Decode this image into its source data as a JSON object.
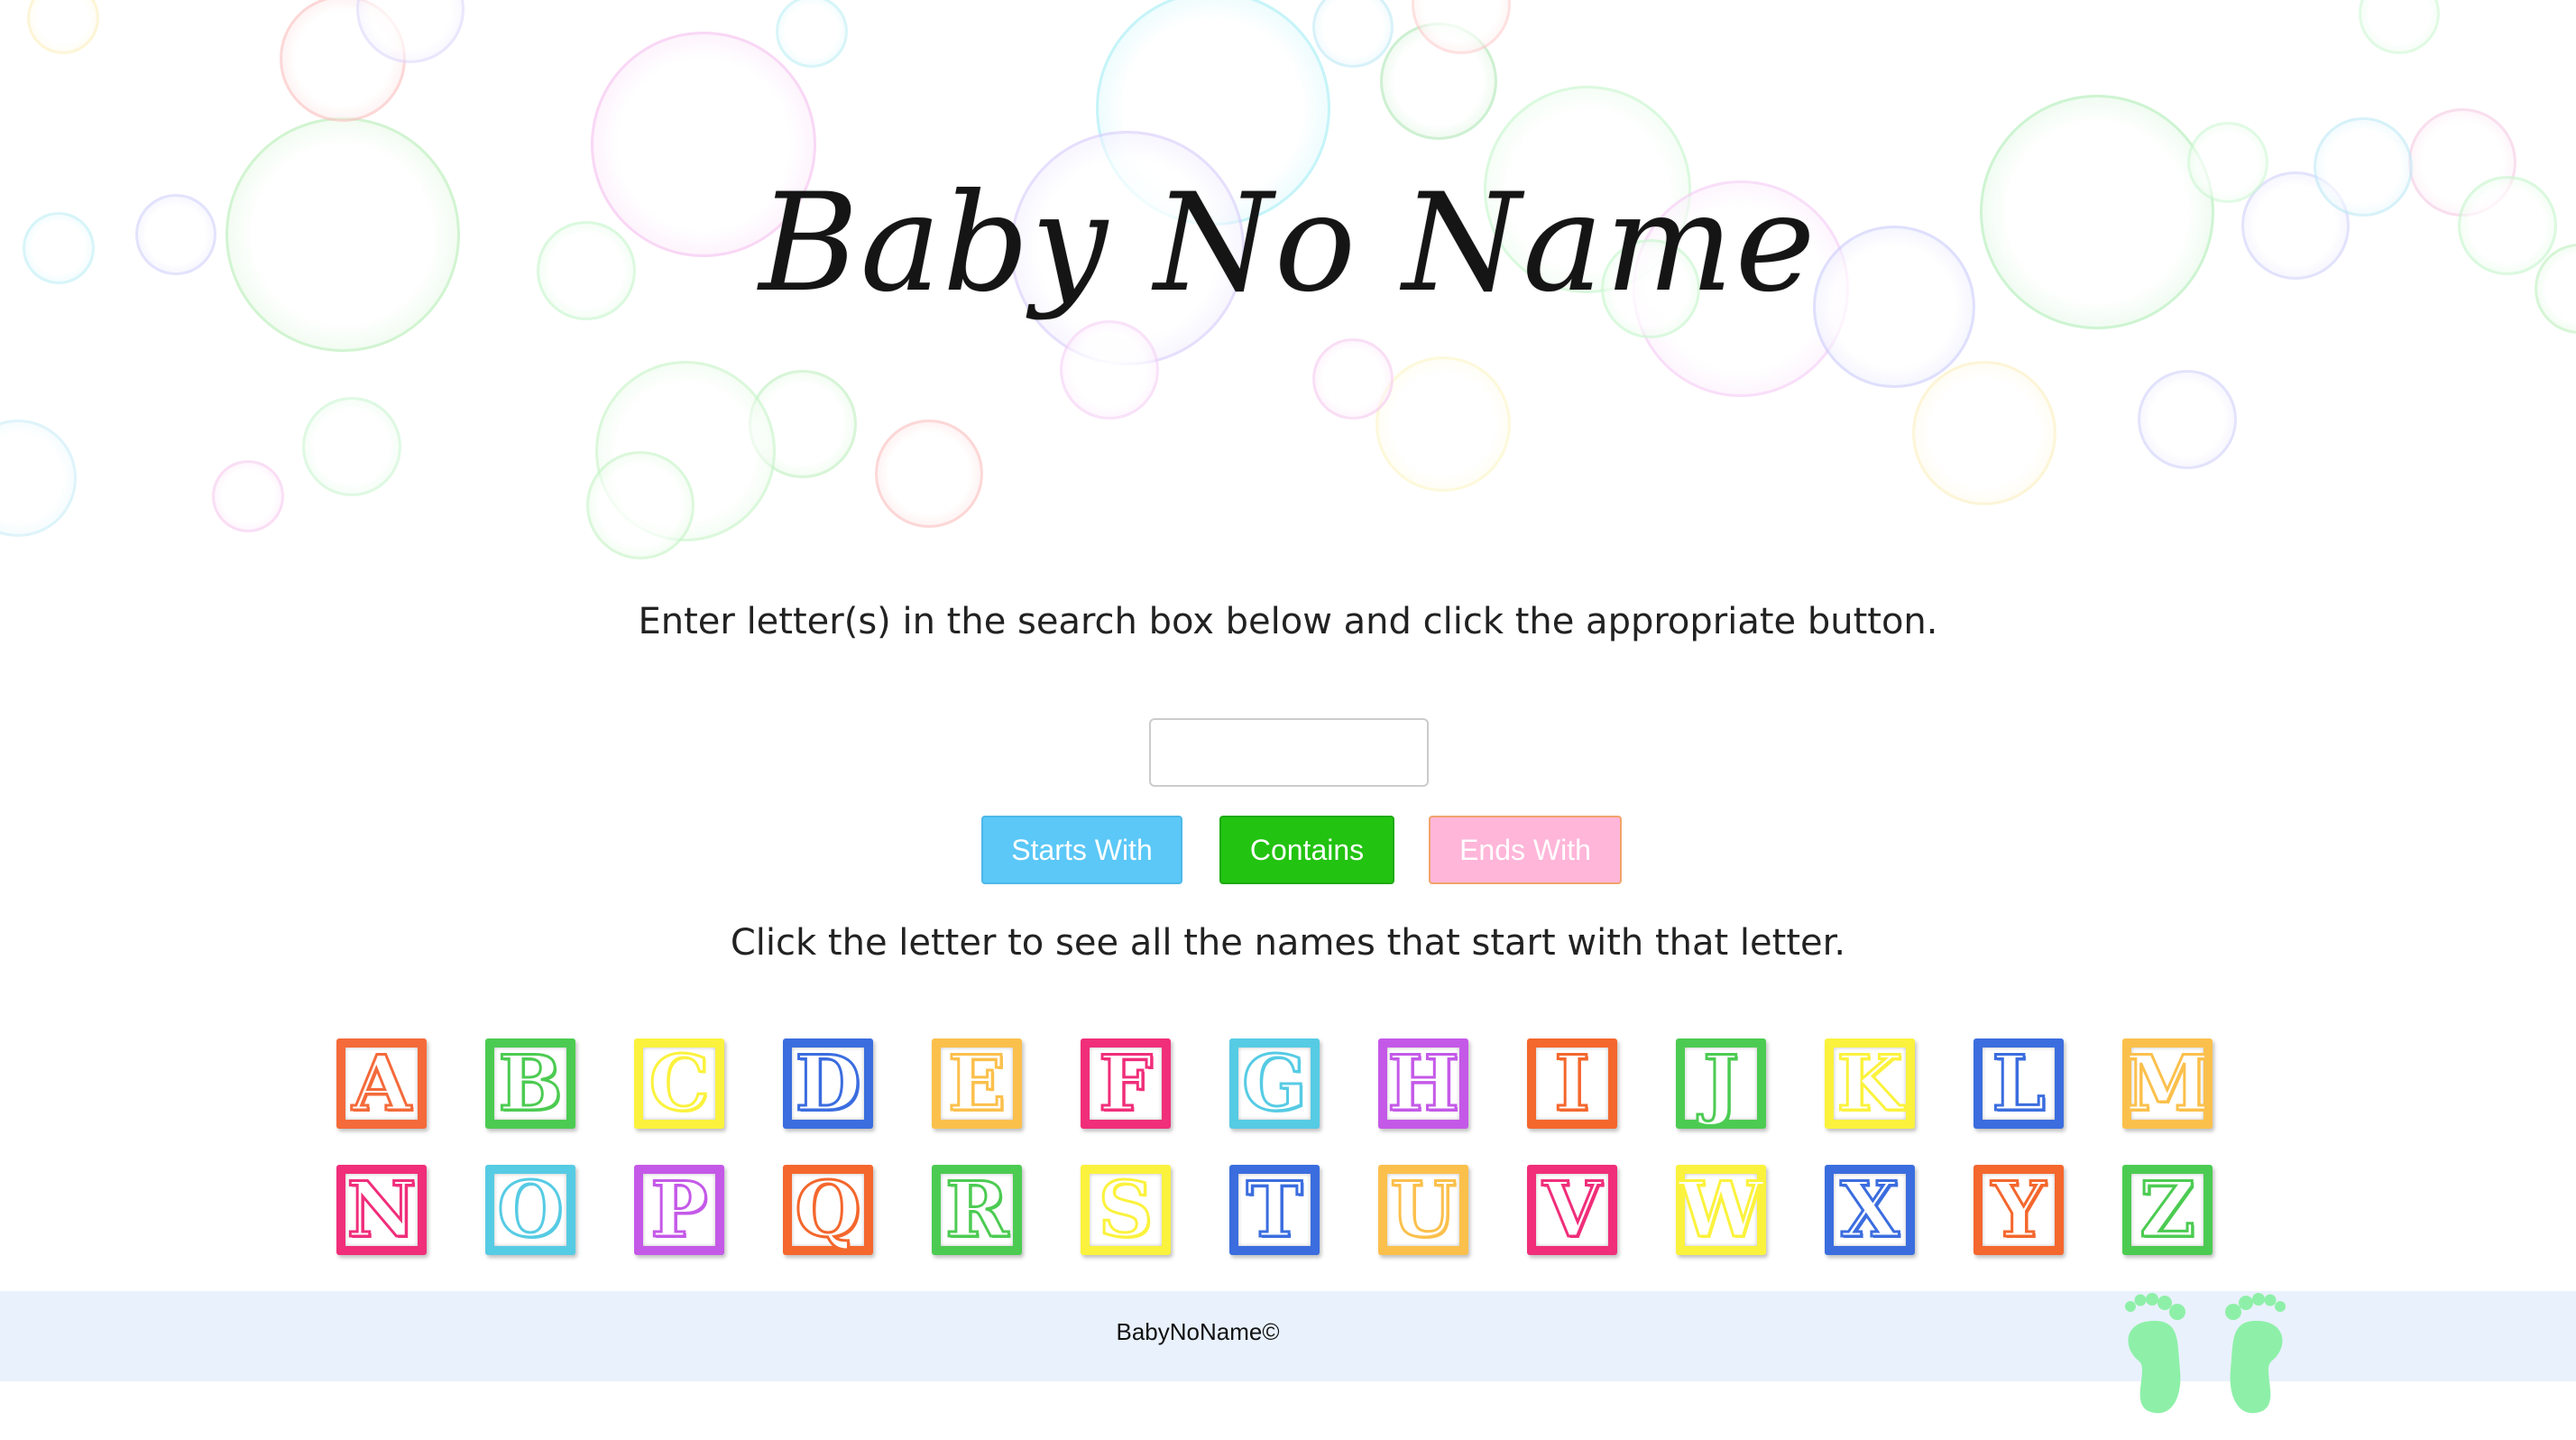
{
  "site": {
    "title": "Baby No Name"
  },
  "search": {
    "instruction": "Enter letter(s) in the search box below and click the appropriate button.",
    "input_value": "",
    "placeholder": ""
  },
  "buttons": {
    "starts_with": "Starts With",
    "contains": "Contains",
    "ends_with": "Ends With"
  },
  "letters": {
    "instruction": "Click the letter to see all the names that start with that letter.",
    "items": [
      {
        "letter": "A",
        "color": "#f46a3a"
      },
      {
        "letter": "B",
        "color": "#4ccb52"
      },
      {
        "letter": "C",
        "color": "#fbf23d"
      },
      {
        "letter": "D",
        "color": "#3b6ddf"
      },
      {
        "letter": "E",
        "color": "#fbc04c"
      },
      {
        "letter": "F",
        "color": "#f02e7a"
      },
      {
        "letter": "G",
        "color": "#56cbe4"
      },
      {
        "letter": "H",
        "color": "#c459e8"
      },
      {
        "letter": "I",
        "color": "#f4672d"
      },
      {
        "letter": "J",
        "color": "#4ccb52"
      },
      {
        "letter": "K",
        "color": "#fbf23d"
      },
      {
        "letter": "L",
        "color": "#3b6ddf"
      },
      {
        "letter": "M",
        "color": "#fbc04c"
      },
      {
        "letter": "N",
        "color": "#f02e7a"
      },
      {
        "letter": "O",
        "color": "#56cbe4"
      },
      {
        "letter": "P",
        "color": "#c459e8"
      },
      {
        "letter": "Q",
        "color": "#f4672d"
      },
      {
        "letter": "R",
        "color": "#4ccb52"
      },
      {
        "letter": "S",
        "color": "#fbf23d"
      },
      {
        "letter": "T",
        "color": "#3b6ddf"
      },
      {
        "letter": "U",
        "color": "#fbc04c"
      },
      {
        "letter": "V",
        "color": "#f02e7a"
      },
      {
        "letter": "W",
        "color": "#fbf23d"
      },
      {
        "letter": "X",
        "color": "#3b6ddf"
      },
      {
        "letter": "Y",
        "color": "#f4672d"
      },
      {
        "letter": "Z",
        "color": "#4ccb52"
      }
    ]
  },
  "footer": {
    "copyright": "BabyNoName©",
    "footprints_icon": "baby-footprints-icon",
    "footprints_color": "#8ef0a8",
    "background": "#e9f1fd"
  },
  "theme": {
    "starts_with_color": "#5bc8f7",
    "contains_color": "#22c311",
    "ends_with_color": "#ffb6d9"
  }
}
